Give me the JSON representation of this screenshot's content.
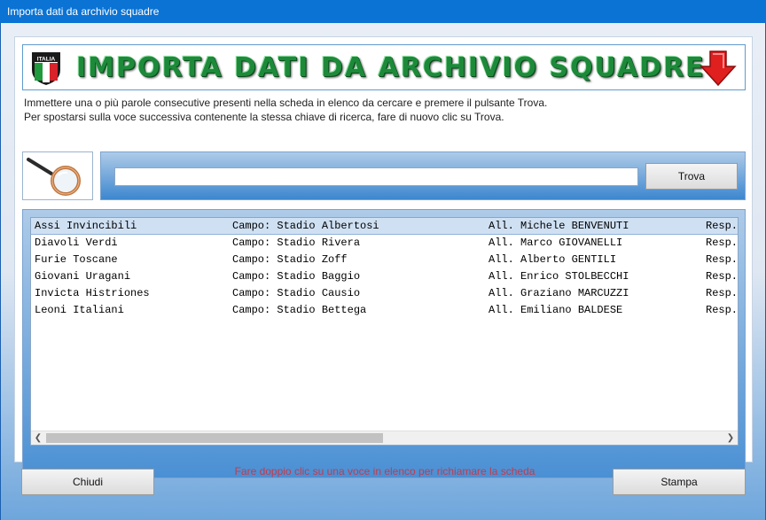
{
  "window": {
    "title": "Importa dati da archivio squadre"
  },
  "banner": {
    "title": "IMPORTA DATI DA ARCHIVIO SQUADRE",
    "shield_text": "ITALIA",
    "accent_green": "#1d8a3a",
    "arrow_color": "#e01f1f"
  },
  "instructions": {
    "line1": "Immettere una o più parole consecutive presenti nella scheda in elenco da cercare e premere il pulsante Trova.",
    "line2": "Per spostarsi sulla voce successiva contenente la stessa chiave di ricerca, fare di nuovo clic su Trova."
  },
  "search": {
    "value": "",
    "button_label": "Trova",
    "icon": "magnifier-icon"
  },
  "list": {
    "selected_index": 0,
    "rows": [
      {
        "name": "Assi Invincibili",
        "campo": "Campo: Stadio Albertosi",
        "allenatore": "All. Michele BENVENUTI",
        "resp": "Resp."
      },
      {
        "name": "Diavoli Verdi",
        "campo": "Campo: Stadio Rivera",
        "allenatore": "All. Marco GIOVANELLI",
        "resp": "Resp."
      },
      {
        "name": "Furie Toscane",
        "campo": "Campo: Stadio Zoff",
        "allenatore": "All. Alberto GENTILI",
        "resp": "Resp."
      },
      {
        "name": "Giovani Uragani",
        "campo": "Campo: Stadio Baggio",
        "allenatore": "All. Enrico STOLBECCHI",
        "resp": "Resp."
      },
      {
        "name": "Invicta Histriones",
        "campo": "Campo: Stadio Causio",
        "allenatore": "All. Graziano MARCUZZI",
        "resp": "Resp."
      },
      {
        "name": "Leoni Italiani",
        "campo": "Campo: Stadio Bettega",
        "allenatore": "All. Emiliano BALDESE",
        "resp": "Resp."
      }
    ]
  },
  "hint": "Fare doppio clic su una voce in elenco per richiamare la scheda",
  "buttons": {
    "close": "Chiudi",
    "print": "Stampa"
  }
}
